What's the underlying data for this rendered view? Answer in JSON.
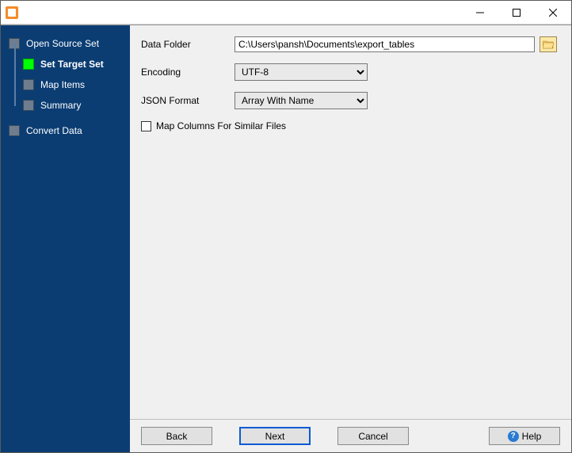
{
  "titlebar": {
    "title": ""
  },
  "sidebar": {
    "items": [
      {
        "label": "Open Source Set"
      },
      {
        "label": "Set Target Set"
      },
      {
        "label": "Map Items"
      },
      {
        "label": "Summary"
      },
      {
        "label": "Convert Data"
      }
    ]
  },
  "form": {
    "data_folder_label": "Data Folder",
    "data_folder_value": "C:\\Users\\pansh\\Documents\\export_tables",
    "encoding_label": "Encoding",
    "encoding_value": "UTF-8",
    "json_format_label": "JSON Format",
    "json_format_value": "Array With Name",
    "map_columns_label": "Map Columns For Similar Files",
    "map_columns_checked": false
  },
  "buttons": {
    "back": "Back",
    "next": "Next",
    "cancel": "Cancel",
    "help": "Help"
  }
}
